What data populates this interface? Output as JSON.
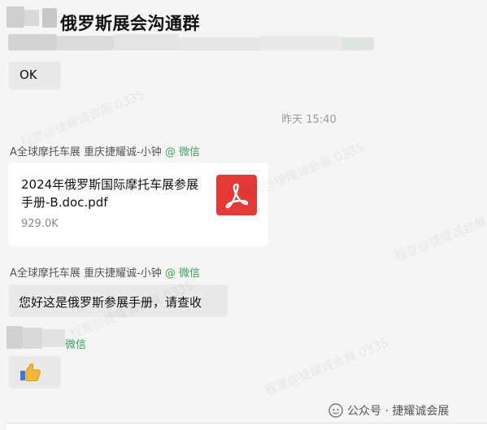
{
  "header": {
    "title": "俄罗斯展会沟通群"
  },
  "messages": {
    "ok_bubble": "OK",
    "timestamp": "昨天 15:40",
    "sender_name": "A全球摩托车展 重庆捷耀诚-小钟",
    "sender_suffix": "@ 微信",
    "file": {
      "name": "2024年俄罗斯国际摩托车展参展手册-B.doc.pdf",
      "size": "929.0K",
      "icon": "pdf-icon"
    },
    "sender2_name": "A全球摩托车展 重庆捷耀诚-小钟",
    "sender2_suffix": "@ 微信",
    "text_bubble": "您好这是俄罗斯参展手册，请查收",
    "sender3_suffix": "微信",
    "emoji_bubble_icon": "thumbs-up-icon"
  },
  "watermarks": {
    "text": "程萱@捷耀诚会展 0335"
  },
  "footer": {
    "label": "公众号 · 捷耀诚会展"
  }
}
